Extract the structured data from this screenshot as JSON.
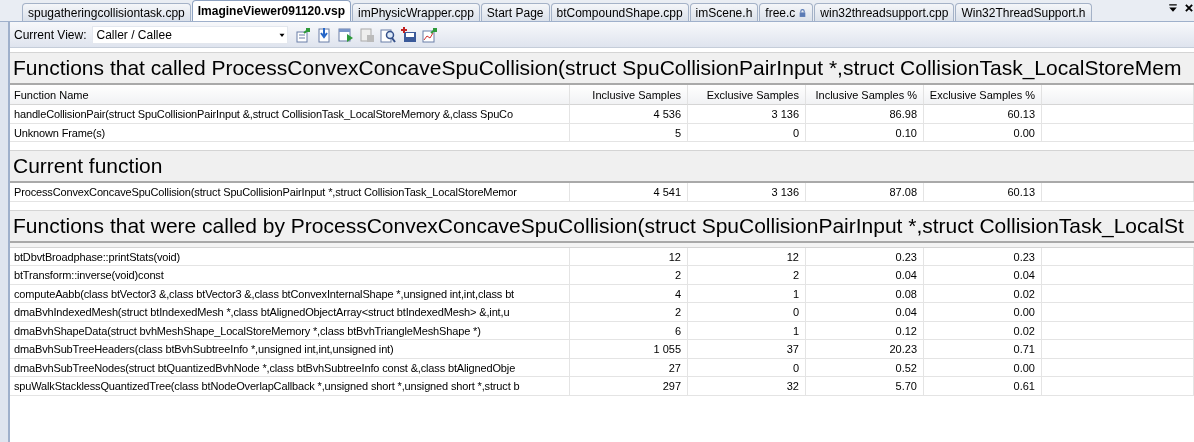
{
  "tabs": [
    {
      "label": "spugatheringcollisiontask.cpp",
      "selected": false,
      "locked": false
    },
    {
      "label": "ImagineViewer091120.vsp",
      "selected": true,
      "locked": false
    },
    {
      "label": "imPhysicWrapper.cpp",
      "selected": false,
      "locked": false
    },
    {
      "label": "Start Page",
      "selected": false,
      "locked": false
    },
    {
      "label": "btCompoundShape.cpp",
      "selected": false,
      "locked": false
    },
    {
      "label": "imScene.h",
      "selected": false,
      "locked": false
    },
    {
      "label": "free.c",
      "selected": false,
      "locked": true
    },
    {
      "label": "win32threadsupport.cpp",
      "selected": false,
      "locked": false
    },
    {
      "label": "Win32ThreadSupport.h",
      "selected": false,
      "locked": false
    }
  ],
  "toolbar": {
    "label": "Current View:",
    "current_view": "Caller / Callee"
  },
  "columns": [
    "Function Name",
    "Inclusive Samples",
    "Exclusive Samples",
    "Inclusive Samples %",
    "Exclusive Samples %"
  ],
  "sections": [
    {
      "kind": "callers",
      "title": "Functions that called ProcessConvexConcaveSpuCollision(struct SpuCollisionPairInput *,struct CollisionTask_LocalStoreMem",
      "rows": [
        {
          "function": "handleCollisionPair(struct SpuCollisionPairInput &,struct CollisionTask_LocalStoreMemory &,class SpuCo",
          "inclusive": "4 536",
          "exclusive": "3 136",
          "inclusive_pct": "86.98",
          "exclusive_pct": "60.13"
        },
        {
          "function": "Unknown Frame(s)",
          "inclusive": "5",
          "exclusive": "0",
          "inclusive_pct": "0.10",
          "exclusive_pct": "0.00"
        }
      ]
    },
    {
      "kind": "current",
      "title": "Current function",
      "rows": [
        {
          "function": "ProcessConvexConcaveSpuCollision(struct SpuCollisionPairInput *,struct CollisionTask_LocalStoreMemor",
          "inclusive": "4 541",
          "exclusive": "3 136",
          "inclusive_pct": "87.08",
          "exclusive_pct": "60.13"
        }
      ]
    },
    {
      "kind": "callees",
      "title": "Functions that were called by ProcessConvexConcaveSpuCollision(struct SpuCollisionPairInput *,struct CollisionTask_LocalSt",
      "rows": [
        {
          "function": "btDbvtBroadphase::printStats(void)",
          "inclusive": "12",
          "exclusive": "12",
          "inclusive_pct": "0.23",
          "exclusive_pct": "0.23"
        },
        {
          "function": "btTransform::inverse(void)const",
          "inclusive": "2",
          "exclusive": "2",
          "inclusive_pct": "0.04",
          "exclusive_pct": "0.04"
        },
        {
          "function": "computeAabb(class btVector3 &,class btVector3 &,class btConvexInternalShape *,unsigned int,int,class bt",
          "inclusive": "4",
          "exclusive": "1",
          "inclusive_pct": "0.08",
          "exclusive_pct": "0.02"
        },
        {
          "function": "dmaBvhIndexedMesh(struct btIndexedMesh *,class btAlignedObjectArray<struct btIndexedMesh> &,int,u",
          "inclusive": "2",
          "exclusive": "0",
          "inclusive_pct": "0.04",
          "exclusive_pct": "0.00"
        },
        {
          "function": "dmaBvhShapeData(struct bvhMeshShape_LocalStoreMemory *,class btBvhTriangleMeshShape *)",
          "inclusive": "6",
          "exclusive": "1",
          "inclusive_pct": "0.12",
          "exclusive_pct": "0.02"
        },
        {
          "function": "dmaBvhSubTreeHeaders(class btBvhSubtreeInfo *,unsigned int,int,unsigned int)",
          "inclusive": "1 055",
          "exclusive": "37",
          "inclusive_pct": "20.23",
          "exclusive_pct": "0.71"
        },
        {
          "function": "dmaBvhSubTreeNodes(struct btQuantizedBvhNode *,class btBvhSubtreeInfo const &,class btAlignedObje",
          "inclusive": "27",
          "exclusive": "0",
          "inclusive_pct": "0.52",
          "exclusive_pct": "0.00"
        },
        {
          "function": "spuWalkStacklessQuantizedTree(class btNodeOverlapCallback *,unsigned short *,unsigned short *,struct b",
          "inclusive": "297",
          "exclusive": "32",
          "inclusive_pct": "5.70",
          "exclusive_pct": "0.61"
        }
      ]
    }
  ]
}
